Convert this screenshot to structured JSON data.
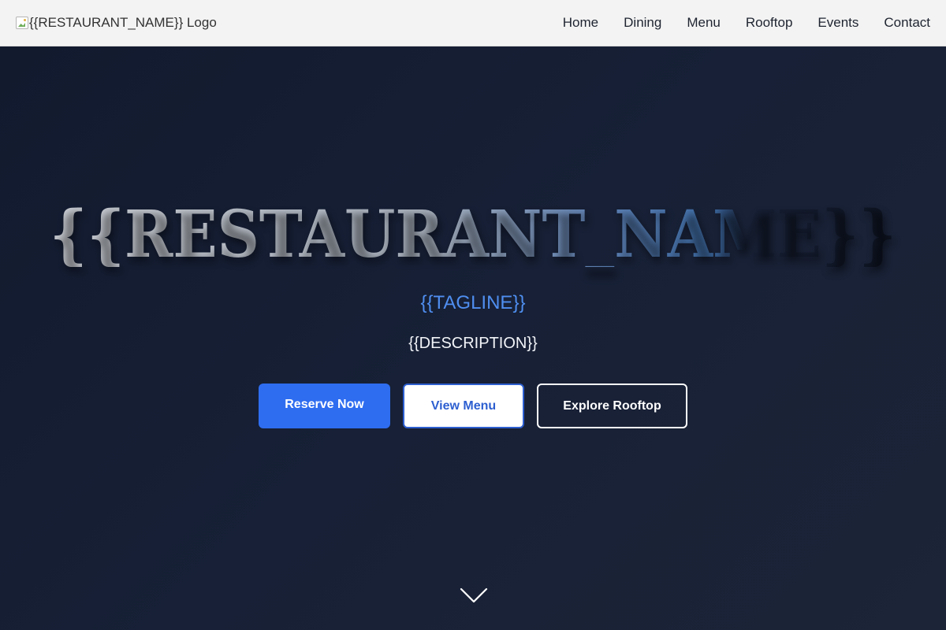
{
  "header": {
    "logo_alt": "{{RESTAURANT_NAME}} Logo",
    "nav": [
      "Home",
      "Dining",
      "Menu",
      "Rooftop",
      "Events",
      "Contact"
    ]
  },
  "hero": {
    "title": "{{RESTAURANT_NAME}}",
    "tagline": "{{TAGLINE}}",
    "description": "{{DESCRIPTION}}",
    "buttons": {
      "reserve": "Reserve Now",
      "menu": "View Menu",
      "rooftop": "Explore Rooftop"
    },
    "scroll_icon": "chevron-down-icon"
  },
  "colors": {
    "nav_bg": "#f3f3f3",
    "hero_bg": "#171f33",
    "accent": "#2f6df0",
    "tagline": "#4f8ef0"
  }
}
